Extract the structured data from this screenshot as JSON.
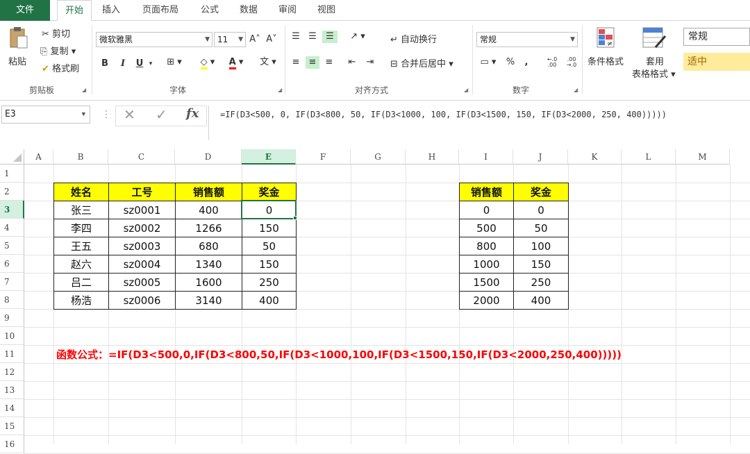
{
  "tabs": [
    "文件",
    "开始",
    "插入",
    "页面布局",
    "公式",
    "数据",
    "审阅",
    "视图"
  ],
  "active_tab": "开始",
  "clipboard": {
    "paste": "粘贴",
    "cut": "剪切",
    "copy": "复制",
    "format_painter": "格式刷",
    "label": "剪贴板"
  },
  "font": {
    "name": "微软雅黑",
    "size": "11",
    "label": "字体",
    "bold": "B",
    "italic": "I",
    "underline": "U"
  },
  "alignment": {
    "wrap": "自动换行",
    "merge": "合并后居中",
    "label": "对齐方式"
  },
  "number": {
    "format": "常规",
    "percent": "%",
    "comma": ",",
    "label": "数字"
  },
  "styles": {
    "conditional": "条件格式",
    "table_format_1": "套用",
    "table_format_2": "表格格式",
    "style_normal": "常规",
    "style_medium": "适中"
  },
  "formula_bar": {
    "name_box": "E3",
    "fx": "fx",
    "formula": "=IF(D3<500, 0, IF(D3<800, 50, IF(D3<1000, 100, IF(D3<1500, 150, IF(D3<2000, 250, 400)))))"
  },
  "columns": [
    "A",
    "B",
    "C",
    "D",
    "E",
    "F",
    "G",
    "H",
    "I",
    "J",
    "K",
    "L",
    "M"
  ],
  "rows": [
    "1",
    "2",
    "3",
    "4",
    "5",
    "6",
    "7",
    "8",
    "9",
    "10",
    "11",
    "12",
    "13",
    "14",
    "15",
    "16"
  ],
  "table1": {
    "headers": [
      "姓名",
      "工号",
      "销售额",
      "奖金"
    ],
    "rows": [
      [
        "张三",
        "sz0001",
        "400",
        "0"
      ],
      [
        "李四",
        "sz0002",
        "1266",
        "150"
      ],
      [
        "王五",
        "sz0003",
        "680",
        "50"
      ],
      [
        "赵六",
        "sz0004",
        "1340",
        "150"
      ],
      [
        "吕二",
        "sz0005",
        "1600",
        "250"
      ],
      [
        "杨浩",
        "sz0006",
        "3140",
        "400"
      ]
    ]
  },
  "table2": {
    "headers": [
      "销售额",
      "奖金"
    ],
    "rows": [
      [
        "0",
        "0"
      ],
      [
        "500",
        "50"
      ],
      [
        "800",
        "100"
      ],
      [
        "1000",
        "150"
      ],
      [
        "1500",
        "250"
      ],
      [
        "2000",
        "400"
      ]
    ]
  },
  "note": "函数公式：=IF(D3<500,0,IF(D3<800,50,IF(D3<1000,100,IF(D3<1500,150,IF(D3<2000,250,400)))))",
  "colors": {
    "accent": "#217346",
    "header_fill": "#ffff00",
    "note": "#ff0000"
  }
}
